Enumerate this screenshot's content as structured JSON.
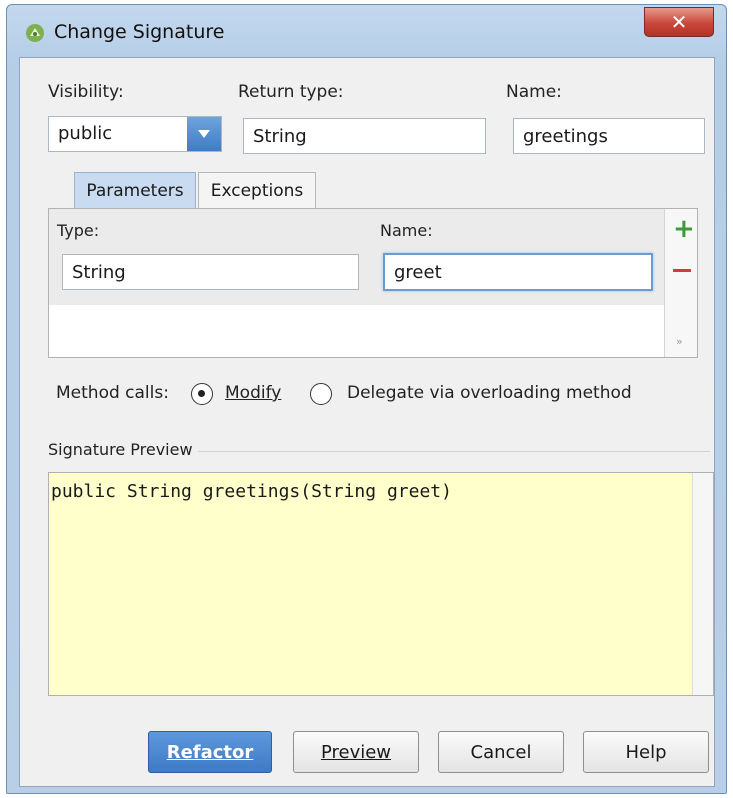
{
  "window": {
    "title": "Change Signature",
    "close_label": "✕"
  },
  "fields": {
    "visibility_label": "Visibility:",
    "visibility_value": "public",
    "return_type_label": "Return type:",
    "return_type_value": "String",
    "name_label": "Name:",
    "name_value": "greetings"
  },
  "tabs": [
    {
      "label": "Parameters",
      "active": true
    },
    {
      "label": "Exceptions",
      "active": false
    }
  ],
  "parameters": {
    "type_header": "Type:",
    "name_header": "Name:",
    "rows": [
      {
        "type": "String",
        "name": "greet"
      }
    ],
    "more_label": "»"
  },
  "method_calls": {
    "label": "Method calls:",
    "options": [
      {
        "label": "Modify",
        "selected": true
      },
      {
        "label": "Delegate via overloading method",
        "selected": false
      }
    ]
  },
  "preview": {
    "label": "Signature Preview",
    "text": "public String greetings(String greet)"
  },
  "buttons": {
    "refactor": "Refactor",
    "preview": "Preview",
    "cancel": "Cancel",
    "help": "Help"
  },
  "colors": {
    "accent": "#4a86cf",
    "add": "#3c9a3c",
    "remove": "#d03a3a",
    "preview_bg": "#ffffcc"
  }
}
